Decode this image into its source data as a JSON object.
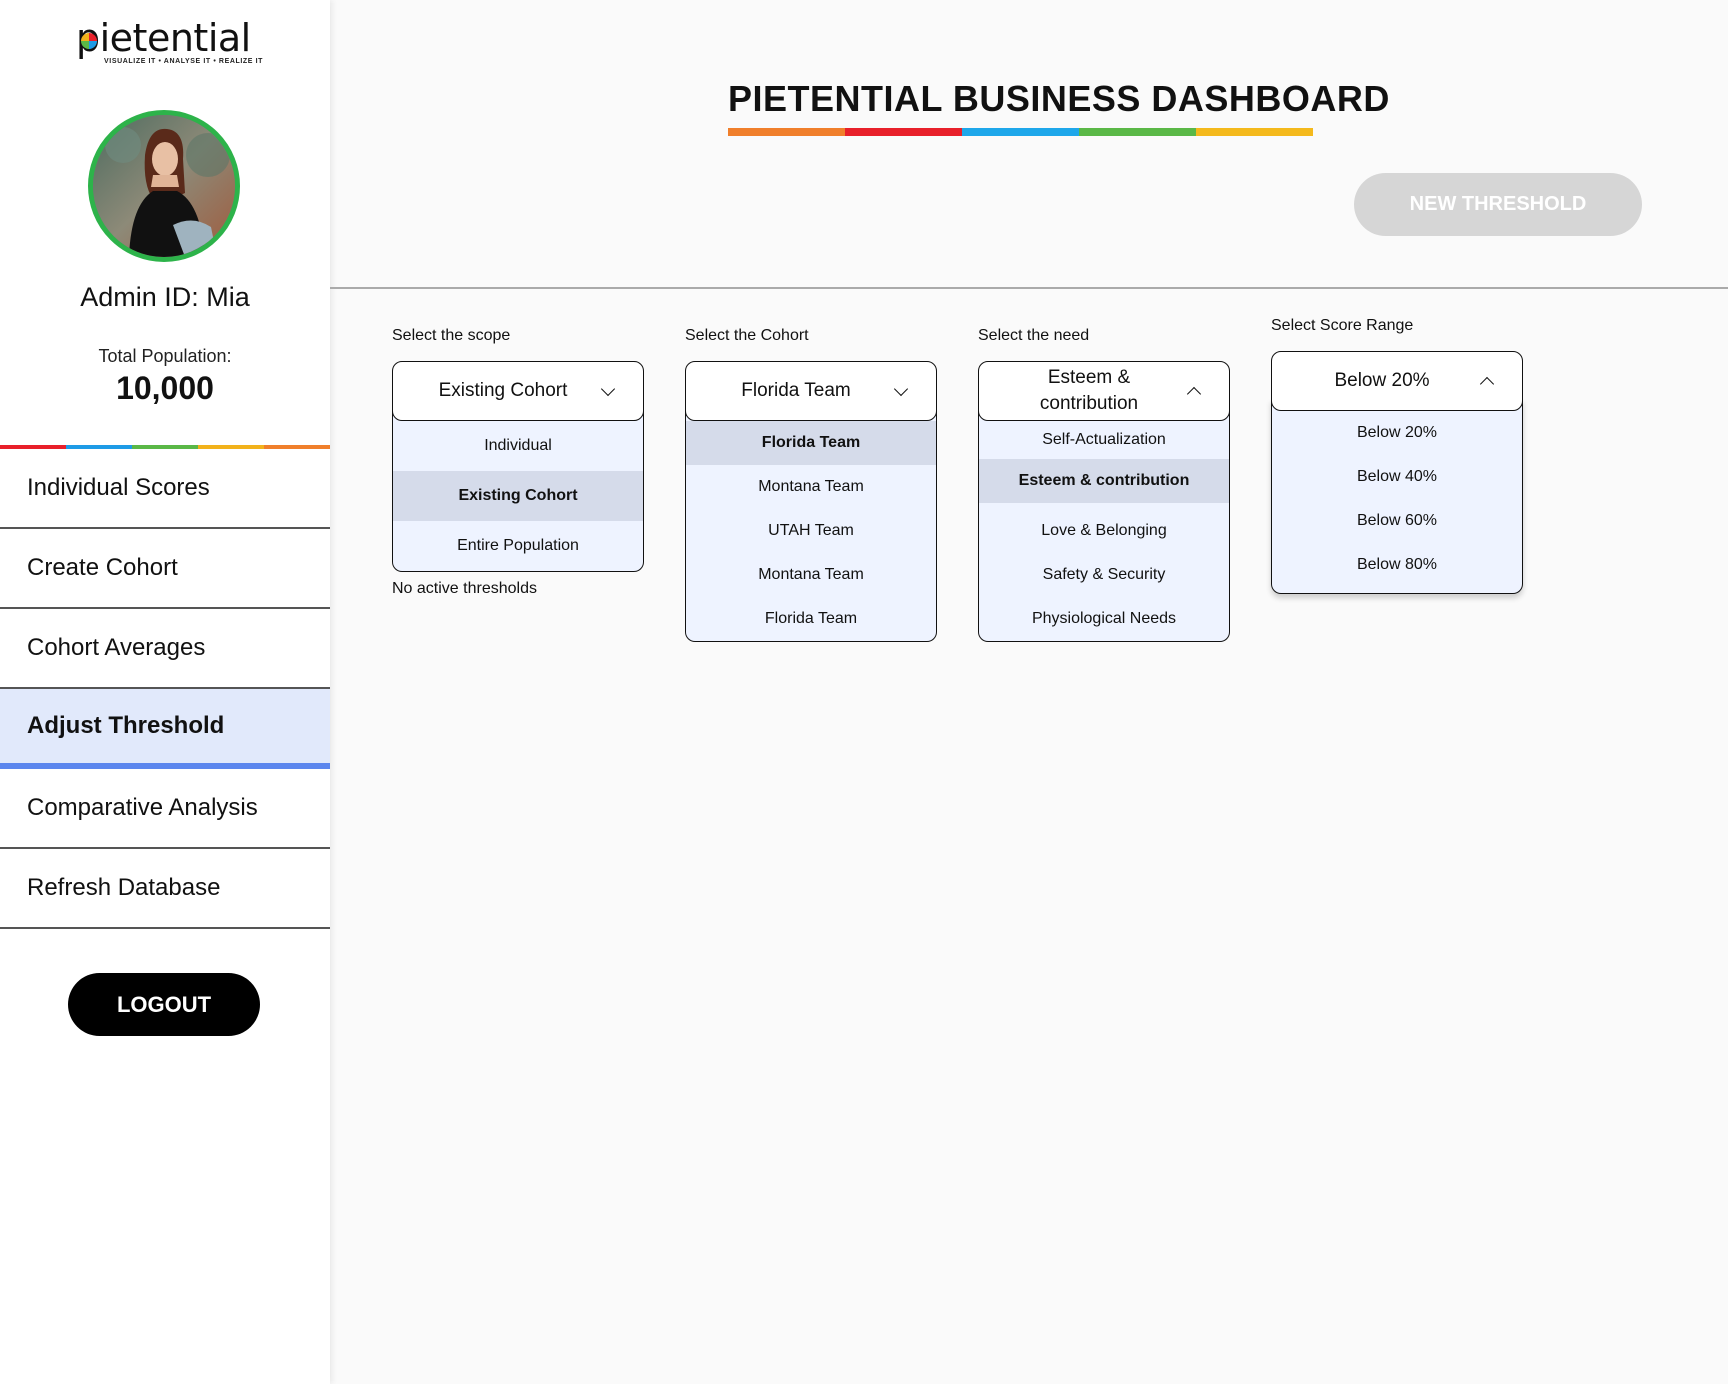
{
  "brand": {
    "logo_text": "pietential",
    "tagline": "VISUALIZE IT • ANALYSE IT • REALIZE IT",
    "rainbow_colors": [
      "#e8202a",
      "#1e9be6",
      "#5ab847",
      "#f2b21b",
      "#f07f2b"
    ]
  },
  "profile": {
    "admin_label": "Admin ID: Mia",
    "population_label": "Total Population:",
    "population_value": "10,000",
    "avatar_ring_color": "#2db34a"
  },
  "nav": {
    "items": [
      {
        "label": "Individual Scores"
      },
      {
        "label": "Create Cohort"
      },
      {
        "label": "Cohort Averages"
      },
      {
        "label": "Adjust Threshold",
        "active": true
      },
      {
        "label": "Comparative Analysis"
      },
      {
        "label": "Refresh Database"
      }
    ],
    "logout_label": "LOGOUT",
    "active_color": "#5b86ee"
  },
  "header": {
    "title": "PIETENTIAL BUSINESS DASHBOARD",
    "title_bar_colors": [
      "#f07f2b",
      "#e8202a",
      "#1ea7ea",
      "#5ab847",
      "#f4b91c"
    ],
    "new_threshold_label": "NEW THRESHOLD"
  },
  "selectors": {
    "scope": {
      "label": "Select the scope",
      "value": "Existing Cohort",
      "options": [
        "Individual",
        "Existing Cohort",
        "Entire Population"
      ],
      "selected_index": 1,
      "note": "No active thresholds"
    },
    "cohort": {
      "label": "Select the Cohort",
      "value": "Florida Team",
      "options": [
        "Florida Team",
        "Montana Team",
        "UTAH Team",
        "Montana Team",
        "Florida Team"
      ],
      "selected_index": 0
    },
    "need": {
      "label": "Select the need",
      "value": "Esteem & contribution",
      "options": [
        "Self-Actualization",
        "Esteem & contribution",
        "Love & Belonging",
        "Safety & Security",
        "Physiological Needs"
      ],
      "selected_index": 1
    },
    "range": {
      "label": "Select Score Range",
      "value": "Below 20%",
      "options": [
        "Below 20%",
        "Below 40%",
        "Below 60%",
        "Below 80%"
      ]
    }
  }
}
